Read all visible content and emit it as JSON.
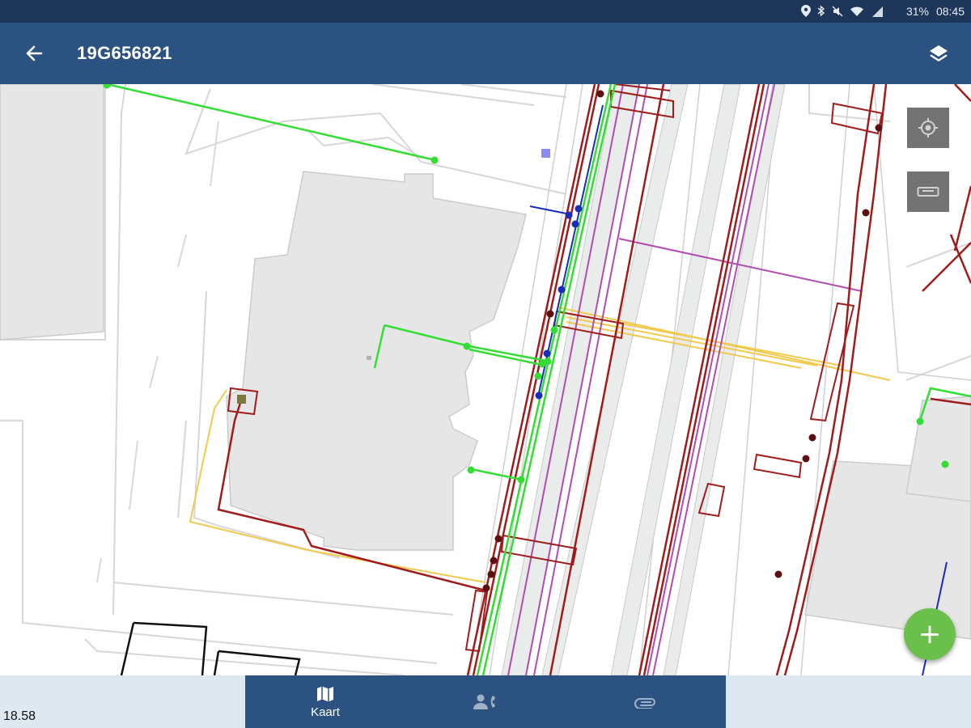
{
  "status_bar": {
    "battery": "31%",
    "time": "08:45",
    "icons": [
      "location-icon",
      "bluetooth-icon",
      "mute-icon",
      "wifi-icon",
      "signal-icon"
    ]
  },
  "app_bar": {
    "title": "19G656821",
    "back_icon": "arrow-left-icon",
    "layers_icon": "layers-icon"
  },
  "map_controls": {
    "locate_icon": "crosshair-icon",
    "measure_icon": "ruler-icon",
    "add_label": "+"
  },
  "scale": {
    "label": "18.58"
  },
  "bottom_nav": {
    "items": [
      {
        "label": "Kaart",
        "icon": "map-icon",
        "active": true
      },
      {
        "label": "",
        "icon": "contact-phone-icon",
        "active": false
      },
      {
        "label": "",
        "icon": "paperclip-icon",
        "active": false
      }
    ]
  },
  "colors": {
    "status_bar": "#1d3659",
    "app_bar": "#2c5282",
    "fab": "#6bc04b",
    "cable_green": "#33dd33",
    "cable_red": "#a01c1c",
    "cable_purple": "#b24bb2",
    "cable_blue": "#1a2cb8",
    "cable_yellow": "#f2c94c",
    "building": "#e6e6e6"
  }
}
